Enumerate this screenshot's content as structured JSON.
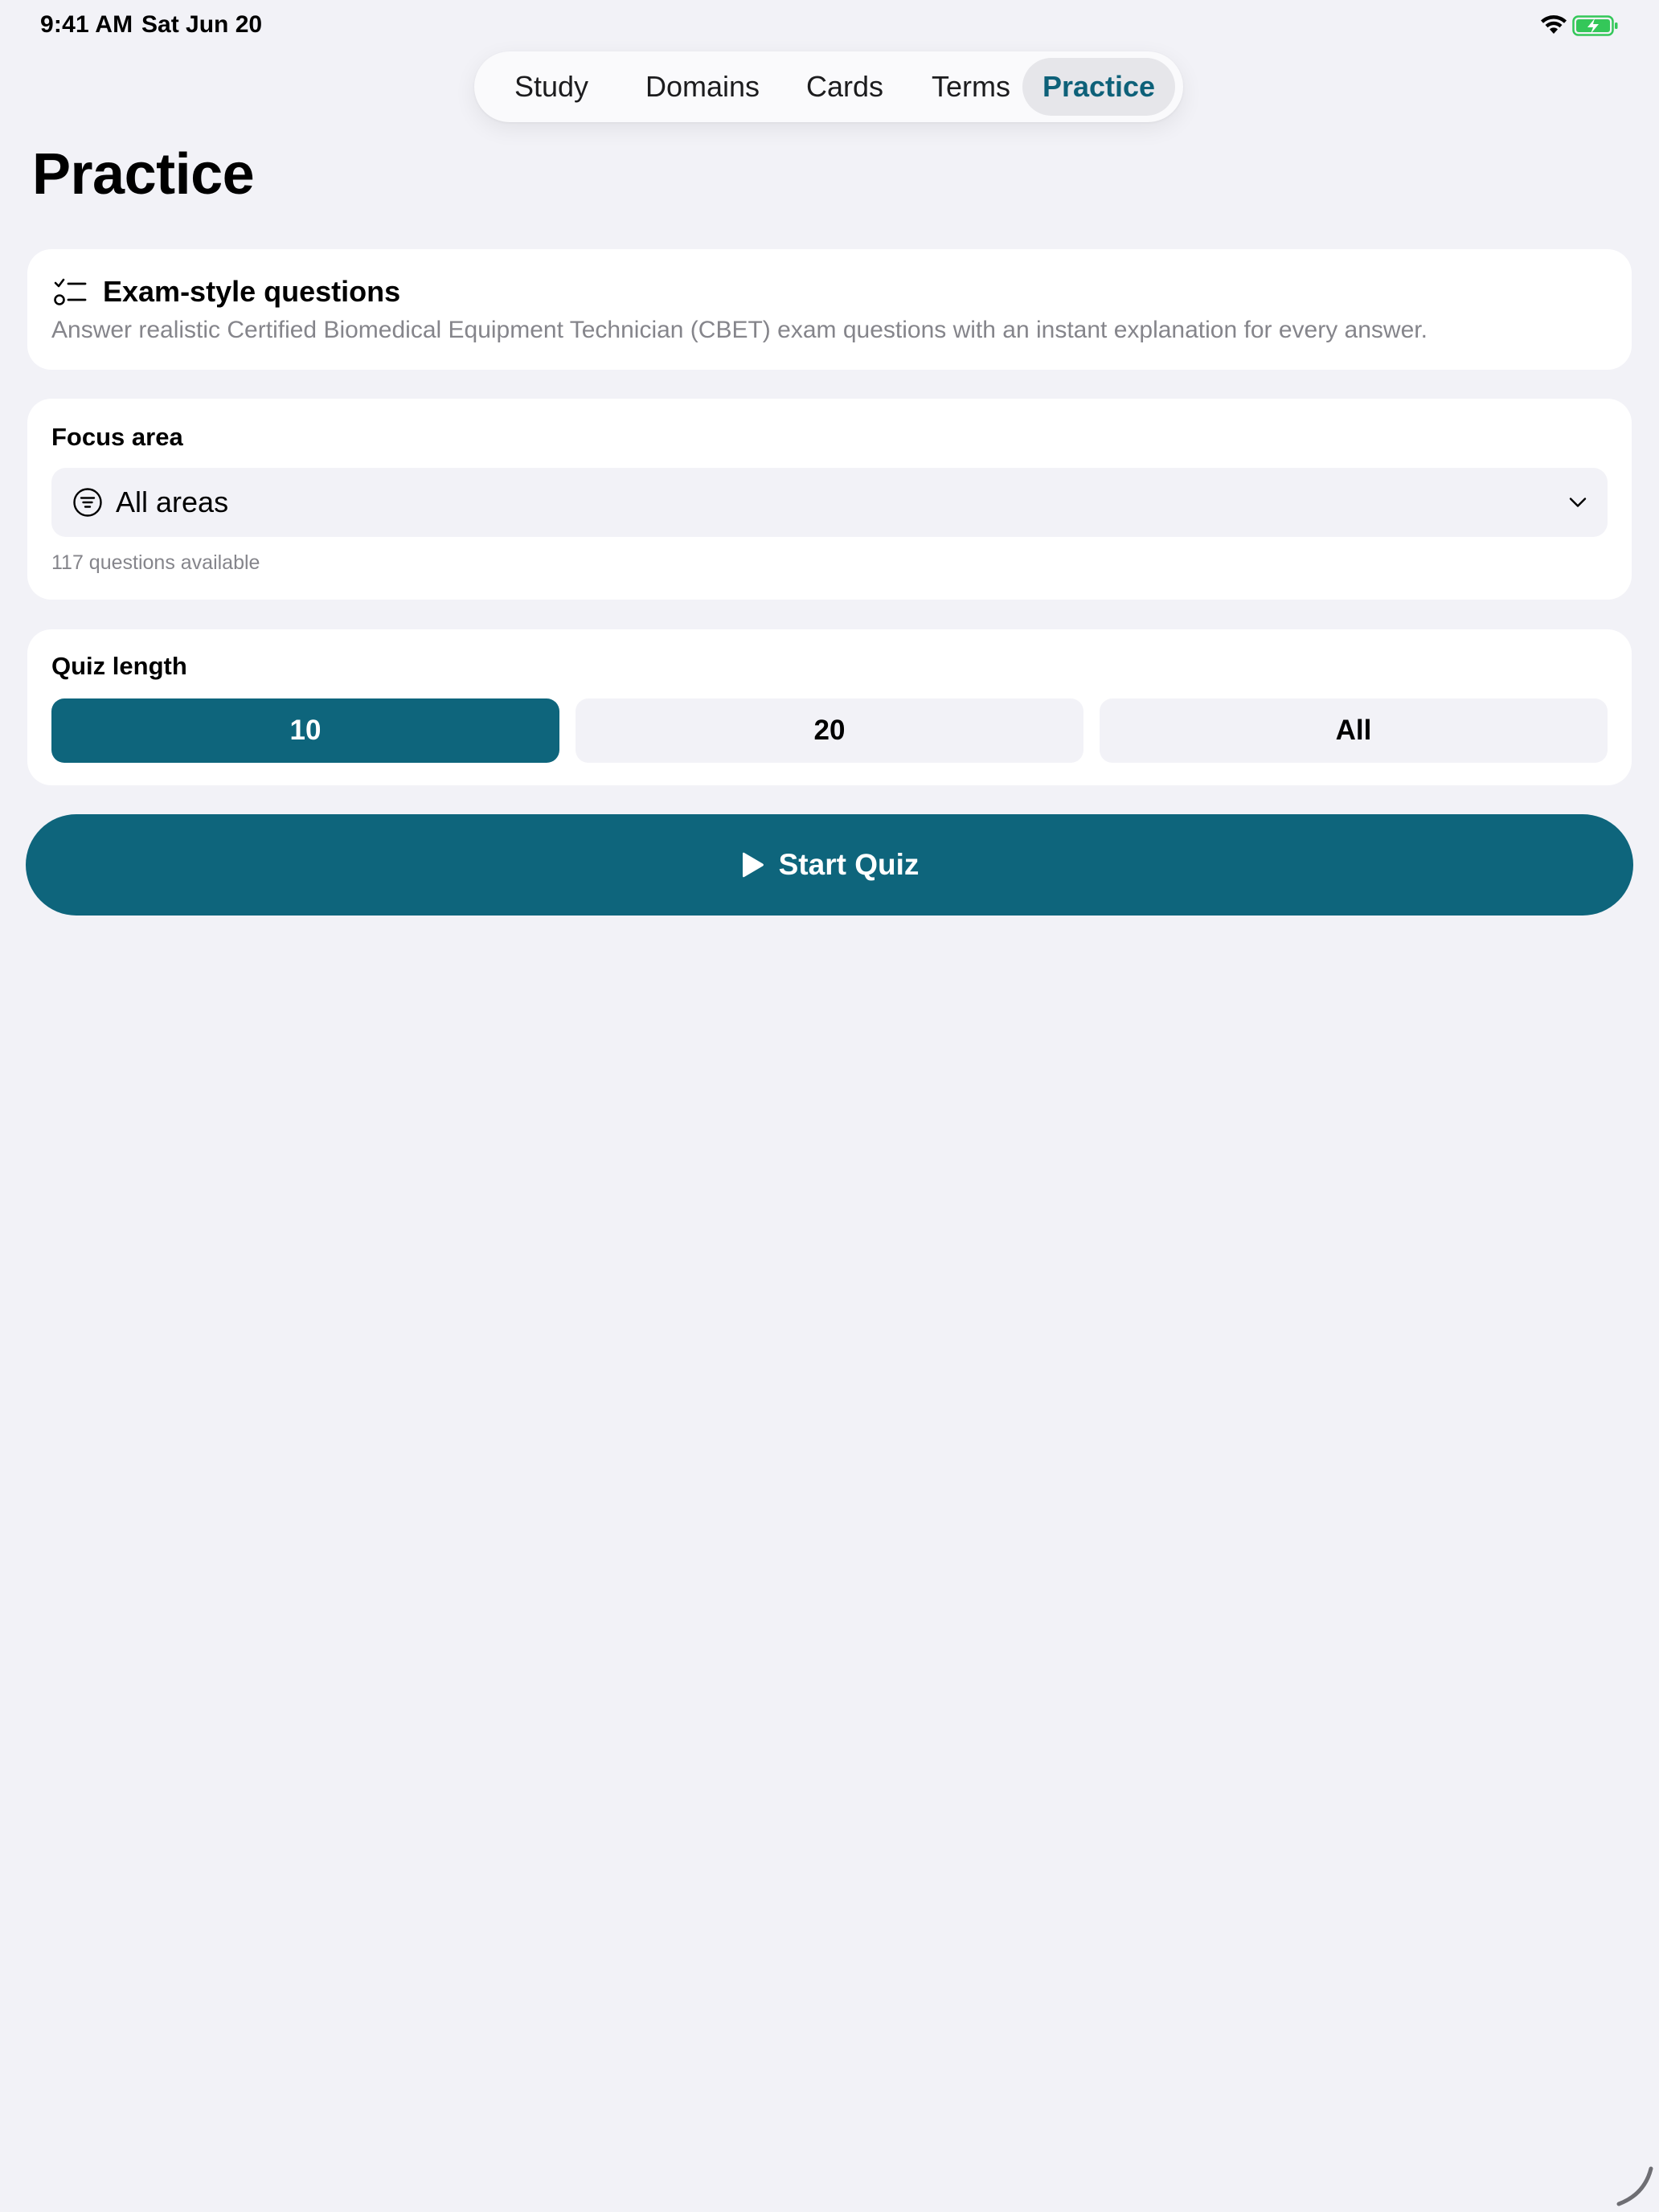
{
  "status_bar": {
    "time": "9:41 AM",
    "date": "Sat Jun 20",
    "wifi_icon": "wifi-icon",
    "battery_icon": "battery-charging-icon",
    "battery_color": "#34c759"
  },
  "tabs": [
    {
      "label": "Study",
      "selected": false
    },
    {
      "label": "Domains",
      "selected": false
    },
    {
      "label": "Cards",
      "selected": false
    },
    {
      "label": "Terms",
      "selected": false
    },
    {
      "label": "Practice",
      "selected": true
    }
  ],
  "page": {
    "title": "Practice"
  },
  "intro": {
    "icon": "checklist-icon",
    "heading": "Exam-style questions",
    "description": "Answer realistic Certified Biomedical Equipment Technician (CBET) exam questions with an instant explanation for every answer."
  },
  "focus": {
    "label": "Focus area",
    "selected": "All areas",
    "icon": "filter-circle-icon",
    "chevron_icon": "chevron-down-icon",
    "count_text": "117 questions available"
  },
  "quiz_length": {
    "label": "Quiz length",
    "options": [
      "10",
      "20",
      "All"
    ],
    "selected": "10"
  },
  "start_button": {
    "label": "Start Quiz",
    "icon": "play-icon"
  },
  "colors": {
    "accent": "#0e657c",
    "background": "#f2f2f7",
    "card": "#ffffff",
    "secondary_text": "#85858b"
  }
}
